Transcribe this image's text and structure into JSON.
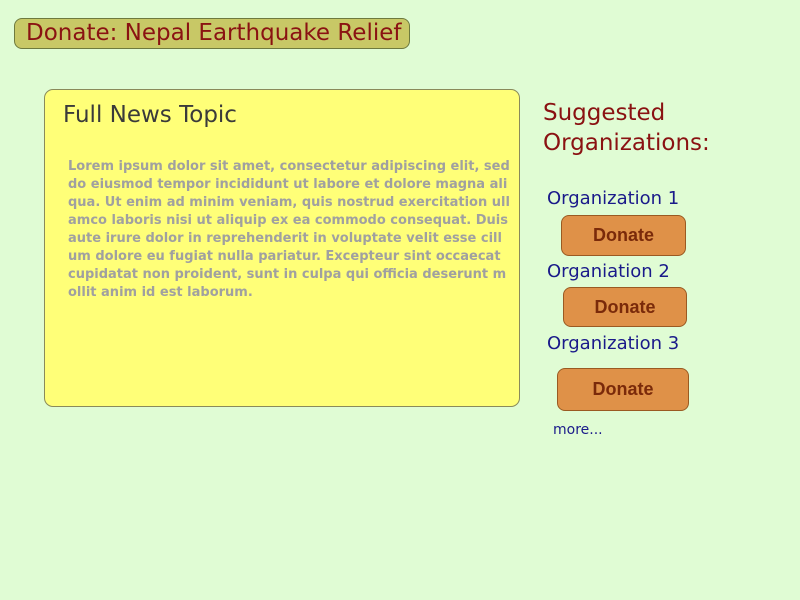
{
  "page": {
    "title": "Donate: Nepal Earthquake Relief"
  },
  "news": {
    "title": "Full News Topic",
    "body": "Lorem ipsum dolor sit amet, consectetur adipiscing elit, sed do eiusmod tempor incididunt ut labore et dolore magna aliqua. Ut enim ad minim veniam, quis nostrud exercitation ullamco laboris nisi ut aliquip ex ea commodo consequat. Duis aute irure dolor in reprehenderit in voluptate velit esse cillum dolore eu fugiat nulla pariatur. Excepteur sint occaecat cupidatat non proident, sunt in culpa qui officia deserunt mollit anim id est laborum."
  },
  "suggestions": {
    "heading": "Suggested\nOrganizations:",
    "organizations": [
      {
        "name": "Organization 1",
        "donate_label": "Donate"
      },
      {
        "name": "Organiation 2",
        "donate_label": "Donate"
      },
      {
        "name": "Organization 3",
        "donate_label": "Donate"
      }
    ],
    "more_label": "more..."
  },
  "colors": {
    "background": "#e0fcd4",
    "title_pill": "#c8c866",
    "title_text": "#8a1212",
    "news_card": "#ffff78",
    "org_text": "#1a1a8a",
    "donate_button": "#df9148",
    "donate_text": "#7a2a0a"
  }
}
